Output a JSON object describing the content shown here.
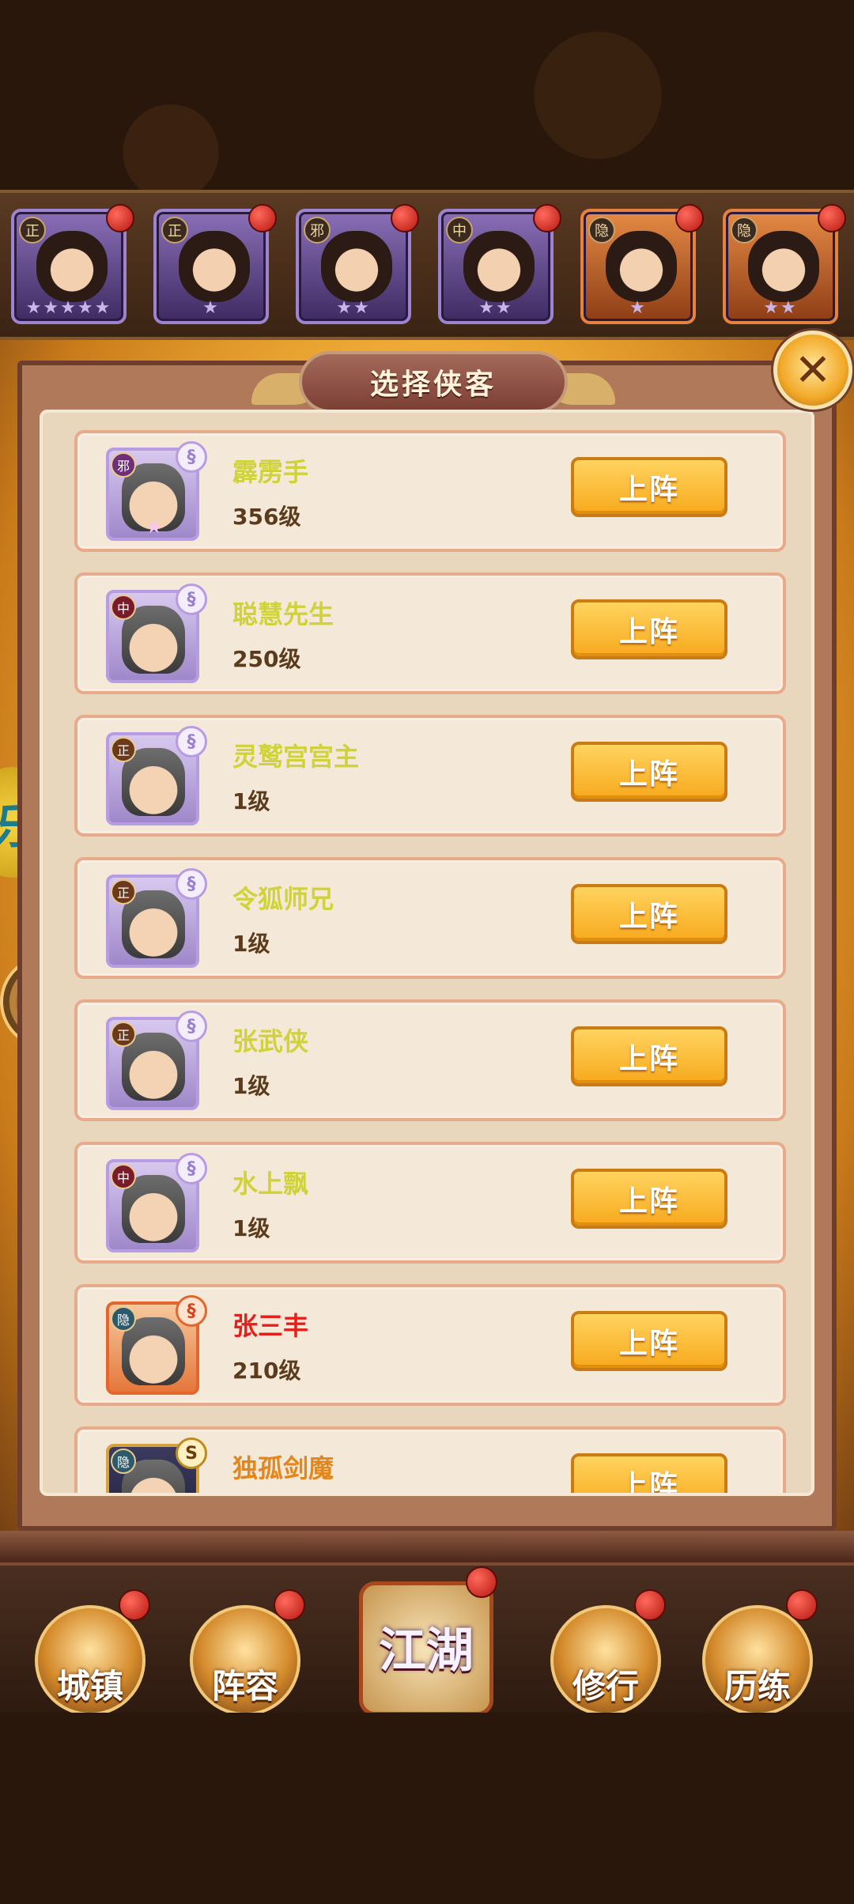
{
  "hero_strip": [
    {
      "faction": "正",
      "stars": "★★★★★",
      "style": "purple"
    },
    {
      "faction": "正",
      "stars": "★",
      "style": "purple"
    },
    {
      "faction": "邪",
      "stars": "★★",
      "style": "purple"
    },
    {
      "faction": "中",
      "stars": "★★",
      "style": "purple"
    },
    {
      "faction": "隐",
      "stars": "★",
      "style": "orange"
    },
    {
      "faction": "隐",
      "stars": "★★",
      "style": "orange"
    }
  ],
  "dialog": {
    "title": "选择侠客",
    "close_icon": "✕"
  },
  "deploy_label": "上阵",
  "heroes": [
    {
      "name": "霹雳手",
      "level": "356级",
      "faction": "邪",
      "name_color": "#cfd23a"
    },
    {
      "name": "聪慧先生",
      "level": "250级",
      "faction": "中",
      "name_color": "#cfd23a"
    },
    {
      "name": "灵鹫宫宫主",
      "level": "1级",
      "faction": "正",
      "name_color": "#cfd23a"
    },
    {
      "name": "令狐师兄",
      "level": "1级",
      "faction": "正",
      "name_color": "#cfd23a"
    },
    {
      "name": "张武侠",
      "level": "1级",
      "faction": "正",
      "name_color": "#cfd23a"
    },
    {
      "name": "水上飘",
      "level": "1级",
      "faction": "中",
      "name_color": "#cfd23a"
    },
    {
      "name": "张三丰",
      "level": "210级",
      "faction": "隐",
      "name_color": "#e3211c"
    },
    {
      "name": "独孤剑魔",
      "level": "",
      "faction": "隐",
      "name_color": "#e3861c"
    }
  ],
  "side": {
    "badge_text": "乐",
    "chat_icon": "···"
  },
  "bottom_nav": [
    {
      "label": "城镇",
      "icon": "town-icon"
    },
    {
      "label": "阵容",
      "icon": "lineup-icon"
    },
    {
      "label": "江湖",
      "icon": "jianghu-scroll-icon"
    },
    {
      "label": "修行",
      "icon": "cultivation-icon"
    },
    {
      "label": "历练",
      "icon": "training-icon"
    }
  ]
}
